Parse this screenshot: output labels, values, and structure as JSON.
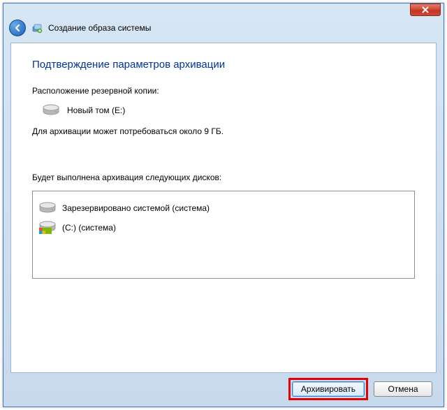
{
  "window": {
    "title": "Создание образа системы"
  },
  "page": {
    "heading": "Подтверждение параметров архивации",
    "backup_location_label": "Расположение резервной копии:",
    "backup_destination": "Новый том (E:)",
    "size_estimate": "Для архивации может потребоваться около 9 ГБ.",
    "disks_label": "Будет выполнена архивация следующих дисков:",
    "disks": [
      {
        "name": "Зарезервировано системой (система)"
      },
      {
        "name": "(C:) (система)"
      }
    ]
  },
  "buttons": {
    "primary": "Архивировать",
    "cancel": "Отмена"
  }
}
